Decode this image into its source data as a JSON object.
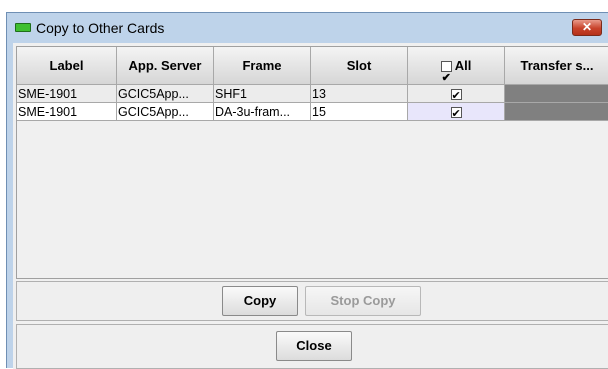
{
  "window": {
    "title": "Copy to Other Cards",
    "close_glyph": "✕"
  },
  "table": {
    "columns": [
      "Label",
      "App. Server",
      "Frame",
      "Slot",
      "All",
      "Transfer s..."
    ],
    "rows": [
      {
        "label": "SME-1901",
        "app_server": "GCIC5App...",
        "frame": "SHF1",
        "slot": "13",
        "checked": true,
        "transfer_status": ""
      },
      {
        "label": "SME-1901",
        "app_server": "GCIC5App...",
        "frame": "DA-3u-fram...",
        "slot": "15",
        "checked": true,
        "transfer_status": ""
      }
    ]
  },
  "buttons": {
    "copy": "Copy",
    "stop_copy": "Stop Copy",
    "close": "Close"
  },
  "colors": {
    "title_bar": "#bed3ea",
    "app_icon": "#3fbf2f",
    "close_button": "#c8432b",
    "transfer_cell": "#808080"
  },
  "icons": [
    "app-icon",
    "close-icon",
    "checkbox-icon"
  ]
}
